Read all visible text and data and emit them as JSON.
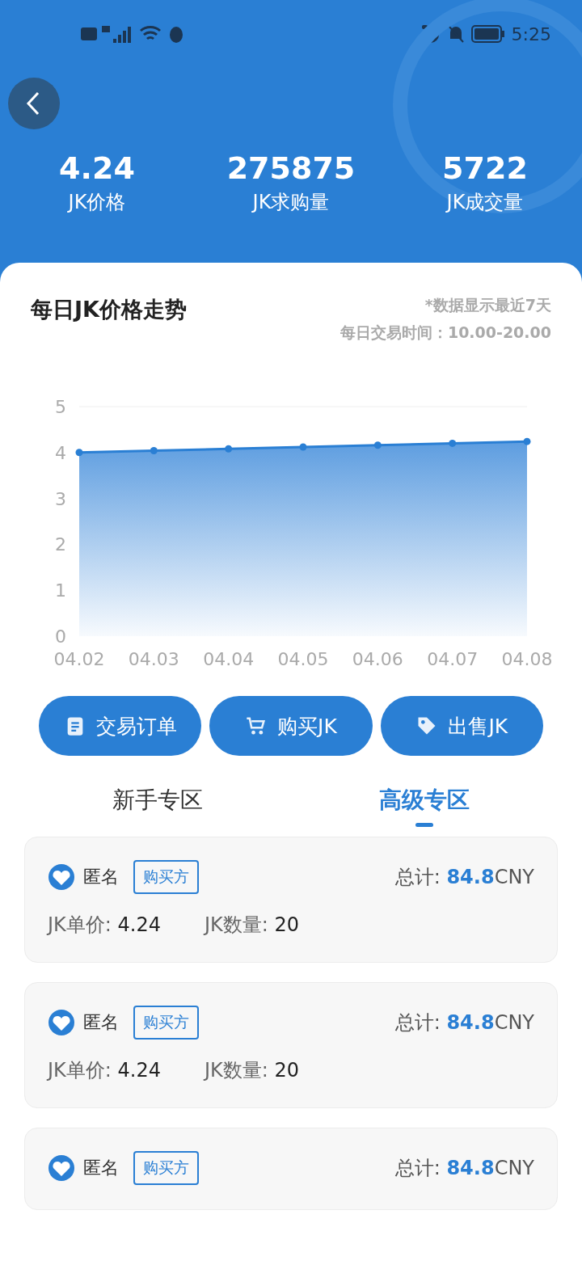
{
  "status_bar": {
    "time": "5:25"
  },
  "stats": [
    {
      "value": "4.24",
      "label": "JK价格"
    },
    {
      "value": "275875",
      "label": "JK求购量"
    },
    {
      "value": "5722",
      "label": "JK成交量"
    }
  ],
  "trend": {
    "title": "每日JK价格走势",
    "note": "*数据显示最近7天",
    "hours": "每日交易时间：10.00-20.00",
    "chart_data": {
      "type": "area",
      "categories": [
        "04.02",
        "04.03",
        "04.04",
        "04.05",
        "04.06",
        "04.07",
        "04.08"
      ],
      "series": [
        {
          "color": "#2a7fd4",
          "values": [
            4.0,
            4.04,
            4.08,
            4.12,
            4.16,
            4.2,
            4.24
          ]
        }
      ],
      "ylim": [
        0,
        5
      ],
      "yticks": [
        0,
        1,
        2,
        3,
        4,
        5
      ]
    }
  },
  "actions": [
    {
      "kind": "orders",
      "label": "交易订单"
    },
    {
      "kind": "buy",
      "label": "购买JK"
    },
    {
      "kind": "sell",
      "label": "出售JK"
    }
  ],
  "tabs": [
    {
      "label": "新手专区",
      "selected": false
    },
    {
      "label": "高级专区",
      "selected": true
    }
  ],
  "orders": [
    {
      "user": "匿名",
      "role": "购买方",
      "total_label": "总计:",
      "total": "84.8",
      "currency": "CNY",
      "price_label": "JK单价:",
      "price": "4.24",
      "qty_label": "JK数量:",
      "qty": "20"
    },
    {
      "user": "匿名",
      "role": "购买方",
      "total_label": "总计:",
      "total": "84.8",
      "currency": "CNY",
      "price_label": "JK单价:",
      "price": "4.24",
      "qty_label": "JK数量:",
      "qty": "20"
    },
    {
      "user": "匿名",
      "role": "购买方",
      "total_label": "总计:",
      "total": "84.8",
      "currency": "CNY"
    }
  ]
}
